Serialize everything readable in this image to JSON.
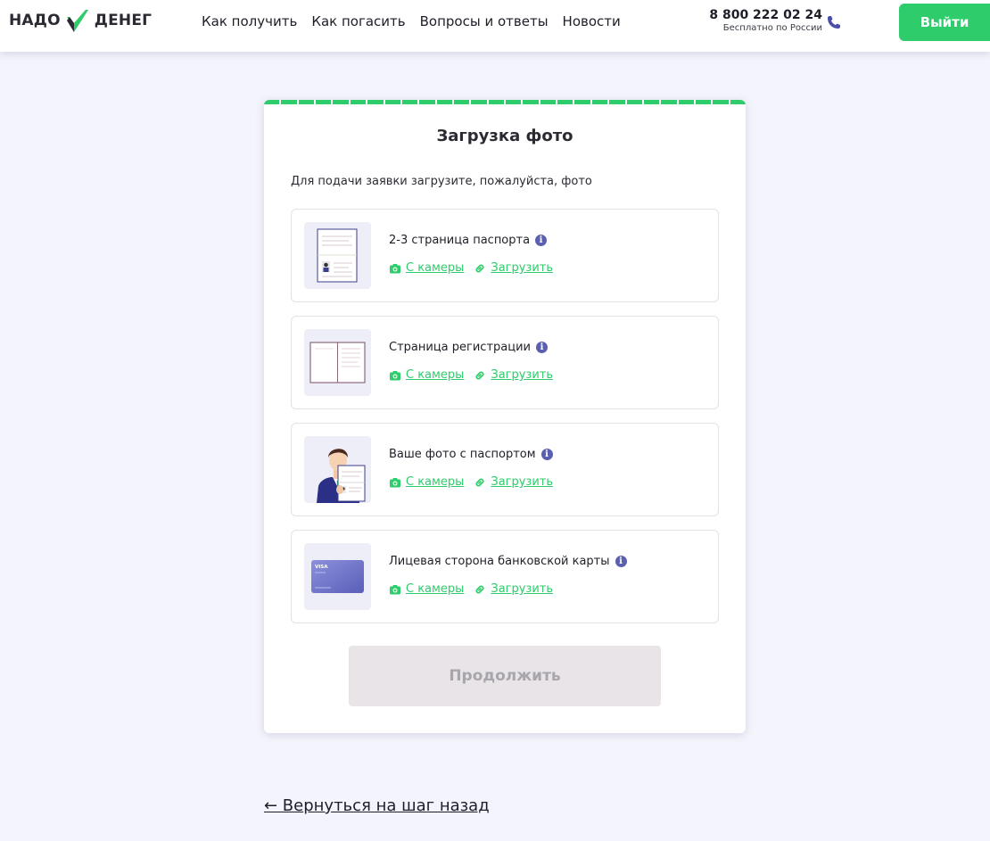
{
  "header": {
    "logo_left": "НАДО",
    "logo_right": "ДЕНЕГ",
    "nav": [
      "Как получить",
      "Как погасить",
      "Вопросы и ответы",
      "Новости"
    ],
    "phone": "8 800 222 02 24",
    "phone_sub": "Бесплатно по России",
    "logout_label": "Выйти"
  },
  "card": {
    "title": "Загрузка фото",
    "subtitle": "Для подачи заявки загрузите, пожалуйста, фото",
    "documents": [
      {
        "label": "2-3 страница паспорта",
        "camera": "С камеры",
        "upload": "Загрузить"
      },
      {
        "label": "Страница регистрации",
        "camera": "С камеры",
        "upload": "Загрузить"
      },
      {
        "label": "Ваше фото с паспортом",
        "camera": "С камеры",
        "upload": "Загрузить"
      },
      {
        "label": "Лицевая сторона банковской карты",
        "camera": "С камеры",
        "upload": "Загрузить"
      }
    ],
    "continue_label": "Продолжить",
    "card_brand": "VISA",
    "progress_fraction": 1.0
  },
  "back_link": "← Вернуться на шаг назад",
  "colors": {
    "accent": "#2ecc6b",
    "info": "#5b5fb0",
    "background": "#f4f4fc",
    "disabled_button": "#e8e4e8"
  },
  "icons": [
    "check-logo-icon",
    "phone-icon",
    "info-icon",
    "camera-icon",
    "link-icon"
  ]
}
